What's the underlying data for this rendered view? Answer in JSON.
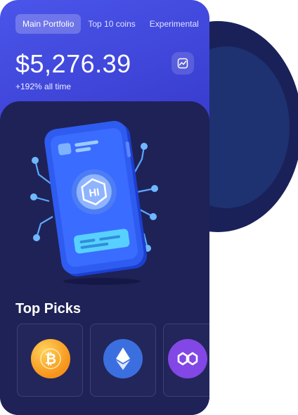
{
  "tabs": [
    {
      "label": "Main Portfolio",
      "active": true
    },
    {
      "label": "Top 10 coins",
      "active": false
    },
    {
      "label": "Experimental",
      "active": false
    }
  ],
  "portfolio": {
    "balance": "$5,276.39",
    "change": "+192% all time"
  },
  "chart_button": {
    "icon": "chart-icon"
  },
  "illustration": {
    "icon": "phone-crypto-icon",
    "emblem": "HI"
  },
  "top_picks": {
    "title": "Top Picks",
    "coins": [
      {
        "icon": "bitcoin-icon",
        "color": "#f7931a"
      },
      {
        "icon": "ethereum-icon",
        "color": "#3b6fe0"
      },
      {
        "icon": "polygon-icon",
        "color": "#8247e5"
      }
    ]
  },
  "colors": {
    "accent": "#4b55ea",
    "panel": "#1f2257",
    "background_circle": "#1a2159"
  }
}
